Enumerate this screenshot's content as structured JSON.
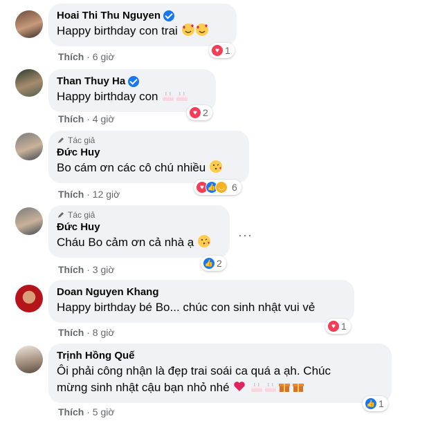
{
  "comments": [
    {
      "author": "Hoai Thi Thu Nguyen",
      "verified": true,
      "text": "Happy birthday con trai",
      "like_label": "Thích",
      "time": "6 giờ",
      "reactions": [
        "heart"
      ],
      "reaction_count": "1"
    },
    {
      "author": "Than Thuy Ha",
      "verified": true,
      "text": "Happy birthday con",
      "like_label": "Thích",
      "time": "4 giờ",
      "reactions": [
        "heart"
      ],
      "reaction_count": "2"
    },
    {
      "badge": "Tác giả",
      "author": "Đức Huy",
      "verified": false,
      "text": "Bo cám ơn các cô chú nhiều",
      "like_label": "Thích",
      "time": "12 giờ",
      "reactions": [
        "heart",
        "like",
        "haha"
      ],
      "reaction_count": "6"
    },
    {
      "badge": "Tác giả",
      "author": "Đức Huy",
      "verified": false,
      "text": "Cháu Bo cảm ơn cả nhà ạ",
      "like_label": "Thích",
      "time": "3 giờ",
      "reactions": [
        "like"
      ],
      "reaction_count": "2"
    },
    {
      "author": "Doan Nguyen Khang",
      "verified": false,
      "text": "Happy birthday bé Bo... chúc con sinh nhật vui vẻ",
      "like_label": "Thích",
      "time": "8 giờ",
      "reactions": [
        "heart"
      ],
      "reaction_count": "1"
    },
    {
      "author": "Trịnh Hồng Quế",
      "verified": false,
      "text_line1": "Ôi phải công nhận là đẹp trai soái ca quá a ạh. Chúc",
      "text_line2": "mừng sinh nhật cậu bạn nhỏ nhé",
      "like_label": "Thích",
      "time": "5 giờ",
      "reactions": [
        "like"
      ],
      "reaction_count": "1"
    }
  ],
  "colors": {
    "bubble": "#f0f2f5",
    "secondary_text": "#65676b",
    "verified": "#1877f2",
    "heart": "#f33e58",
    "like": "#1877f2"
  },
  "icons": [
    "verified-badge-icon",
    "pen-icon",
    "heart-reaction-icon",
    "like-reaction-icon",
    "haha-reaction-icon",
    "more-dots-icon",
    "smiling-hearts-emoji",
    "birthday-cake-emoji",
    "blowing-kiss-emoji",
    "gift-emoji",
    "red-heart-emoji"
  ]
}
